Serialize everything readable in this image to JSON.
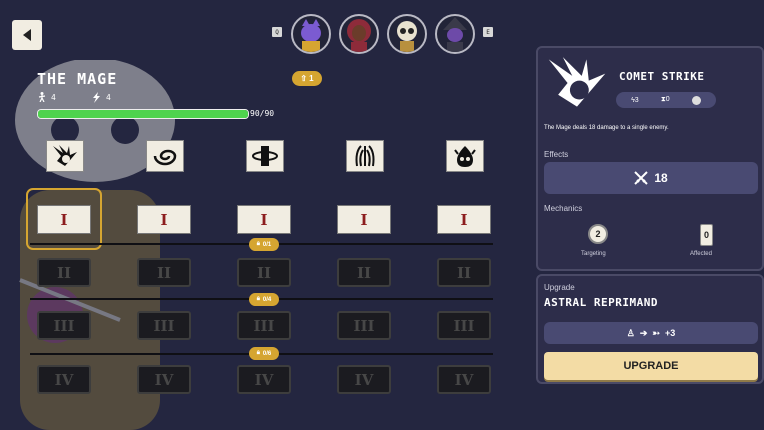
{
  "colors": {
    "background": "#242640",
    "panel": "#2d2d4a",
    "accent_gold": "#d5a531",
    "hp_green": "#4fd34e",
    "button_cream": "#f3dca5",
    "tile_cream": "#f1ede2"
  },
  "nav": {
    "back_icon": "arrow-left-icon"
  },
  "party": {
    "prev_key": "Q",
    "next_key": "E",
    "heroes": [
      {
        "icon": "purple-cat-portrait-icon",
        "color": "#7b5bd1"
      },
      {
        "icon": "red-haired-woman-portrait-icon",
        "color": "#8e2b3a"
      },
      {
        "icon": "skull-portrait-icon",
        "color": "#e8e2cf"
      },
      {
        "icon": "witch-portrait-icon",
        "color": "#6d4aa8"
      }
    ]
  },
  "character": {
    "name": "THE MAGE",
    "move_stat": "4",
    "energy_stat": "4",
    "hp_current": 90,
    "hp_max": 90,
    "hp_text": "90/90",
    "level_badge": "1"
  },
  "skill_tree": {
    "skills": [
      {
        "icon": "comet-strike-icon"
      },
      {
        "icon": "vortex-icon"
      },
      {
        "icon": "totem-icon"
      },
      {
        "icon": "claw-burst-icon"
      },
      {
        "icon": "spirit-flame-icon"
      }
    ],
    "tiers": [
      {
        "label": "I",
        "locked": false
      },
      {
        "label": "II",
        "locked": true,
        "requirement": "0/1"
      },
      {
        "label": "III",
        "locked": true,
        "requirement": "0/4"
      },
      {
        "label": "IV",
        "locked": true,
        "requirement": "0/6"
      }
    ],
    "selected": {
      "skill": 0,
      "tier": 0
    }
  },
  "detail": {
    "skill_name": "COMET STRIKE",
    "skill_icon": "comet-strike-icon",
    "cost": {
      "energy": "3",
      "cooldown": "0",
      "curse_icon": "skull-token-icon"
    },
    "description": "The Mage deals 18 damage to a single enemy.",
    "effects_label": "Effects",
    "effect_value": "18",
    "effect_icon": "crossed-swords-icon",
    "mechanics_label": "Mechanics",
    "targeting_value": "2",
    "targeting_label": "Targeting",
    "affected_value": "0",
    "affected_label": "Affected"
  },
  "upgrade": {
    "section_label": "Upgrade",
    "name": "ASTRAL REPRIMAND",
    "effect_text": "+3",
    "button_label": "UPGRADE"
  }
}
